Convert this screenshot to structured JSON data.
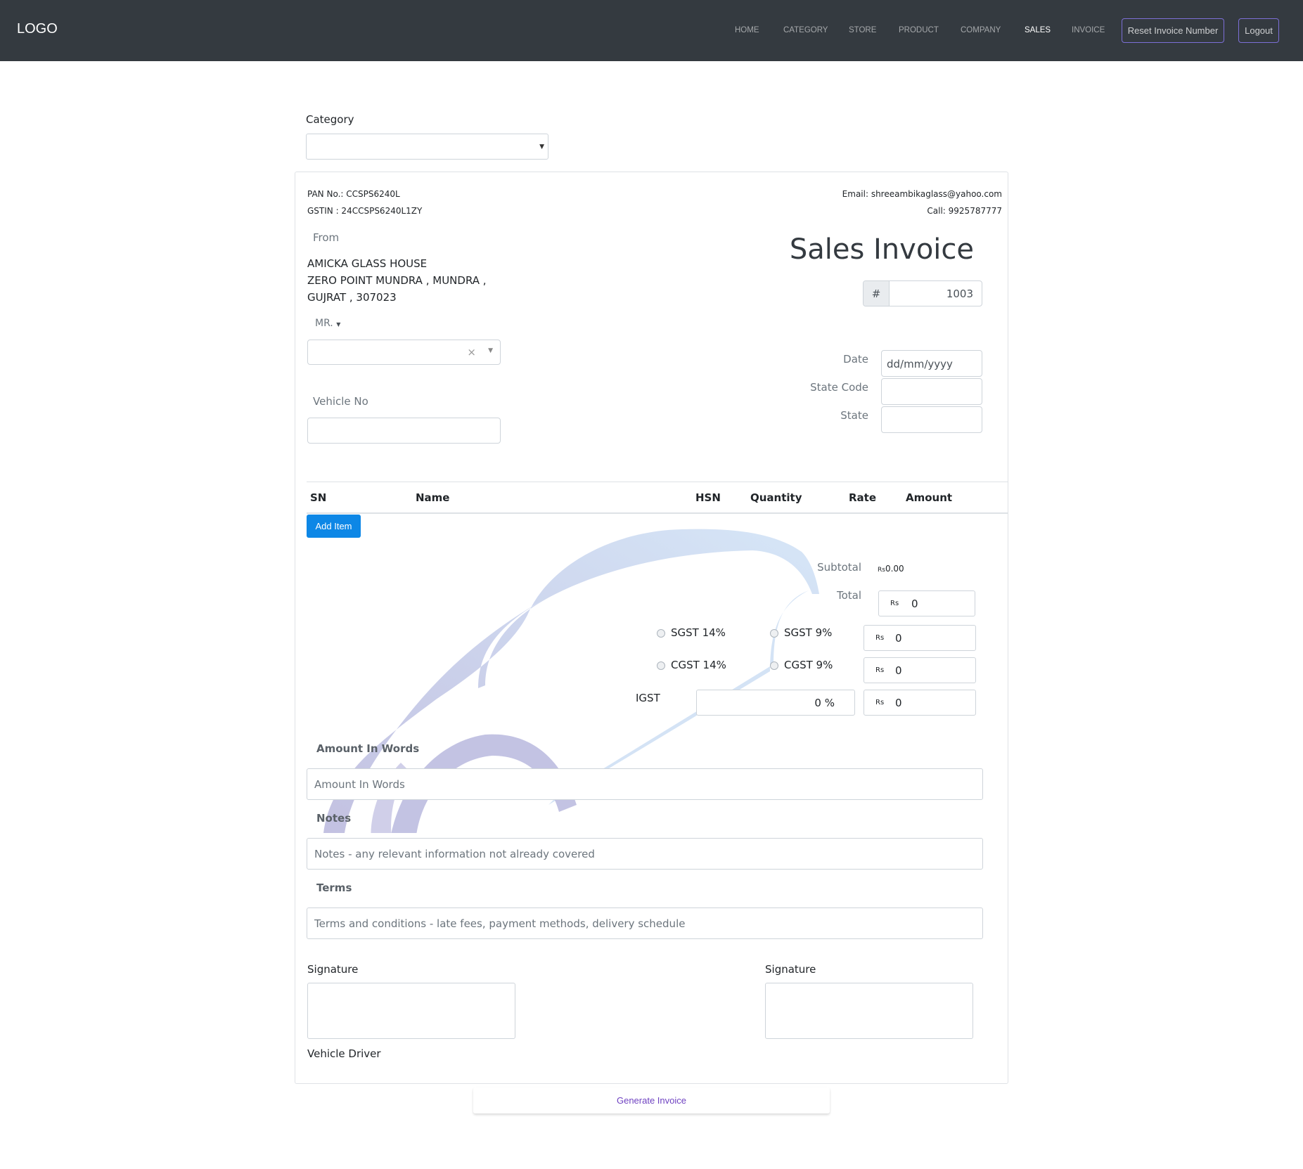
{
  "nav": {
    "logo": "LOGO",
    "links": [
      "HOME",
      "CATEGORY",
      "STORE",
      "PRODUCT",
      "COMPANY",
      "SALES",
      "INVOICE"
    ],
    "active": "SALES",
    "reset_button": "Reset Invoice Number",
    "logout_button": "Logout"
  },
  "category": {
    "label": "Category",
    "value": ""
  },
  "invoice": {
    "pan": "PAN No.: CCSPS6240L",
    "gstin": "GSTIN : 24CCSPS6240L1ZY",
    "email": "Email: shreeambikaglass@yahoo.com",
    "call": "Call: 9925787777",
    "from_label": "From",
    "from_lines": [
      "AMICKA GLASS HOUSE",
      "ZERO POINT MUNDRA , MUNDRA ,",
      "GUJRAT , 307023"
    ],
    "title": "Sales Invoice",
    "number_prefix": "#",
    "number": "1003",
    "salutation": "MR.",
    "customer_clear": "×",
    "vehicle_label": "Vehicle No",
    "date_label": "Date",
    "date_placeholder": "dd/mm/yyyy",
    "state_code_label": "State Code",
    "state_label": "State"
  },
  "table": {
    "columns": [
      "SN",
      "Name",
      "HSN",
      "Quantity",
      "Rate",
      "Amount"
    ],
    "add_item": "Add Item"
  },
  "totals": {
    "subtotal_label": "Subtotal",
    "subtotal_currency": "Rs",
    "subtotal_value": "0.00",
    "total_label": "Total",
    "currency": "Rs",
    "total_value": "0",
    "sgst14": "SGST 14%",
    "sgst9": "SGST 9%",
    "cgst14": "CGST 14%",
    "cgst9": "CGST 9%",
    "sgst_value": "0",
    "cgst_value": "0",
    "igst_label": "IGST",
    "igst_percent": "0 %",
    "igst_value": "0"
  },
  "words": {
    "label": "Amount In Words",
    "placeholder": "Amount In Words"
  },
  "notes": {
    "label": "Notes",
    "placeholder": "Notes - any relevant information not already covered"
  },
  "terms": {
    "label": "Terms",
    "placeholder": "Terms and conditions - late fees, payment methods, delivery schedule"
  },
  "signatures": {
    "left_label": "Signature",
    "right_label": "Signature",
    "left_caption": "Vehicle Driver"
  },
  "generate_button": "Generate Invoice"
}
